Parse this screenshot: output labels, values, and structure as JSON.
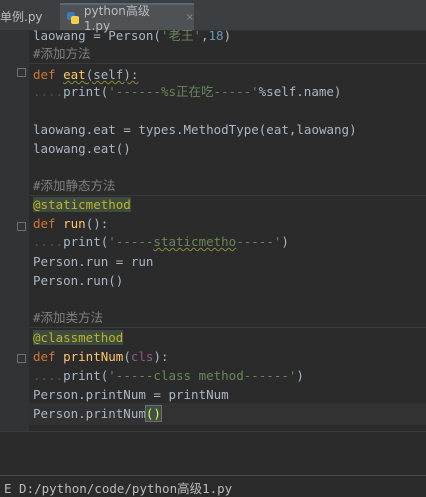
{
  "tabs": [
    {
      "label": "单例.py",
      "close": "×"
    },
    {
      "label": "python高级1.py",
      "close": "×"
    }
  ],
  "code": {
    "l1": {
      "a": "laowang = Person(",
      "s": "'老王'",
      "b": ",",
      "n": "18",
      "c": ")"
    },
    "l2": "#添加方法",
    "l3": {
      "def": "def ",
      "fn": "eat",
      "args": "(self):"
    },
    "l4": {
      "dots": "....",
      "print": "print(",
      "s": "'------%s正在吃-----'",
      "rest": "%self.name)"
    },
    "l6": {
      "a": "laowang.eat = types.MethodType(eat",
      "b": ",",
      "c": "laowang)"
    },
    "l7": "laowang.eat()",
    "l9": "#添加静态方法",
    "l10": "@staticmethod",
    "l11": {
      "def": "def ",
      "fn": "run",
      "args": "():"
    },
    "l12": {
      "dots": "....",
      "print": "print(",
      "s1": "'-----",
      "s2": "staticmetho",
      "s3": "-----'",
      "c": ")"
    },
    "l13": "Person.run = run",
    "l14": "Person.run()",
    "l16": "#添加类方法",
    "l17": "@classmethod",
    "l18": {
      "def": "def ",
      "fn": "printNum",
      "args1": "(",
      "cls": "cls",
      "args2": "):"
    },
    "l19": {
      "dots": "....",
      "print": "print(",
      "s": "'-----class method------'",
      "c": ")"
    },
    "l20": "Person.printNum = printNum",
    "l21": {
      "a": "Person.printNum",
      "b": "()"
    }
  },
  "run_output": "E D:/python/code/python高级1.py"
}
